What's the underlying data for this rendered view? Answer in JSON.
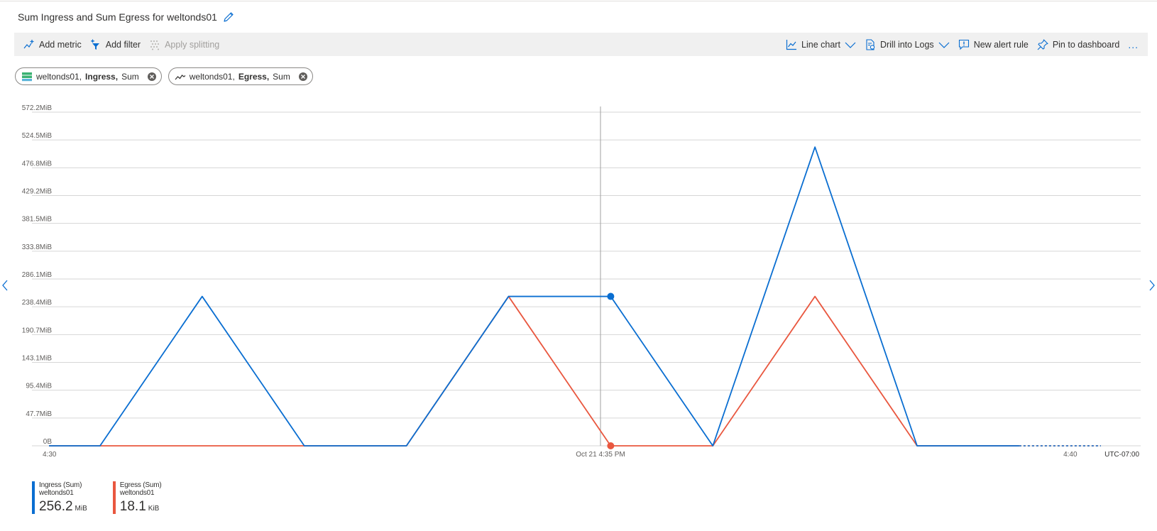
{
  "title": "Sum Ingress and Sum Egress for weltonds01",
  "toolbar": {
    "add_metric": "Add metric",
    "add_filter": "Add filter",
    "apply_splitting": "Apply splitting",
    "line_chart": "Line chart",
    "drill_into_logs": "Drill into Logs",
    "new_alert_rule": "New alert rule",
    "pin_to_dashboard": "Pin to dashboard",
    "more": "..."
  },
  "pills": [
    {
      "resource": "weltonds01,",
      "metric": "Ingress,",
      "aggregation": "Sum",
      "icon": "storage-icon"
    },
    {
      "resource": "weltonds01,",
      "metric": "Egress,",
      "aggregation": "Sum",
      "icon": "line-metric-icon"
    }
  ],
  "colors": {
    "ingress": "#0a6ed1",
    "egress": "#e9573f",
    "grid": "#d6d6d6",
    "cursor": "#a0a0a0"
  },
  "chart_data": {
    "type": "line",
    "y_ticks": [
      "0B",
      "47.7MiB",
      "95.4MiB",
      "143.1MiB",
      "190.7MiB",
      "238.4MiB",
      "286.1MiB",
      "333.8MiB",
      "381.5MiB",
      "429.2MiB",
      "476.8MiB",
      "524.5MiB",
      "572.2MiB"
    ],
    "ylim": [
      0,
      572.2
    ],
    "y_unit": "MiB",
    "x_ticks": [
      {
        "label": "4:30",
        "minute": 0
      },
      {
        "label": "Oct 21 4:35 PM",
        "minute": 5.4
      },
      {
        "label": "4:40",
        "minute": 10
      }
    ],
    "timezone": "UTC-07:00",
    "x_range_minutes": [
      0,
      10.3
    ],
    "series": [
      {
        "name": "Ingress (Sum)",
        "key": "ingress",
        "dashed_from_index": 10,
        "values": [
          0,
          0,
          256.2,
          0,
          0,
          256.2,
          256.2,
          0,
          512.4,
          0,
          0,
          0
        ]
      },
      {
        "name": "Egress (Sum)",
        "key": "egress",
        "dashed_from_index": 10,
        "values": [
          0,
          0,
          0,
          0,
          0,
          256.2,
          0.02,
          0,
          256.2,
          0,
          0,
          0
        ]
      }
    ],
    "x_points_minutes": [
      0,
      0.5,
      1.5,
      2.5,
      3.5,
      4.5,
      5.5,
      6.5,
      7.5,
      8.5,
      9.5,
      10.3
    ],
    "cursor_minute": 5.4,
    "marker_index": 6
  },
  "legend": [
    {
      "line1": "Ingress (Sum)",
      "line2": "weltonds01",
      "value": "256.2",
      "unit": "MiB",
      "key": "ingress"
    },
    {
      "line1": "Egress (Sum)",
      "line2": "weltonds01",
      "value": "18.1",
      "unit": "KiB",
      "key": "egress"
    }
  ]
}
